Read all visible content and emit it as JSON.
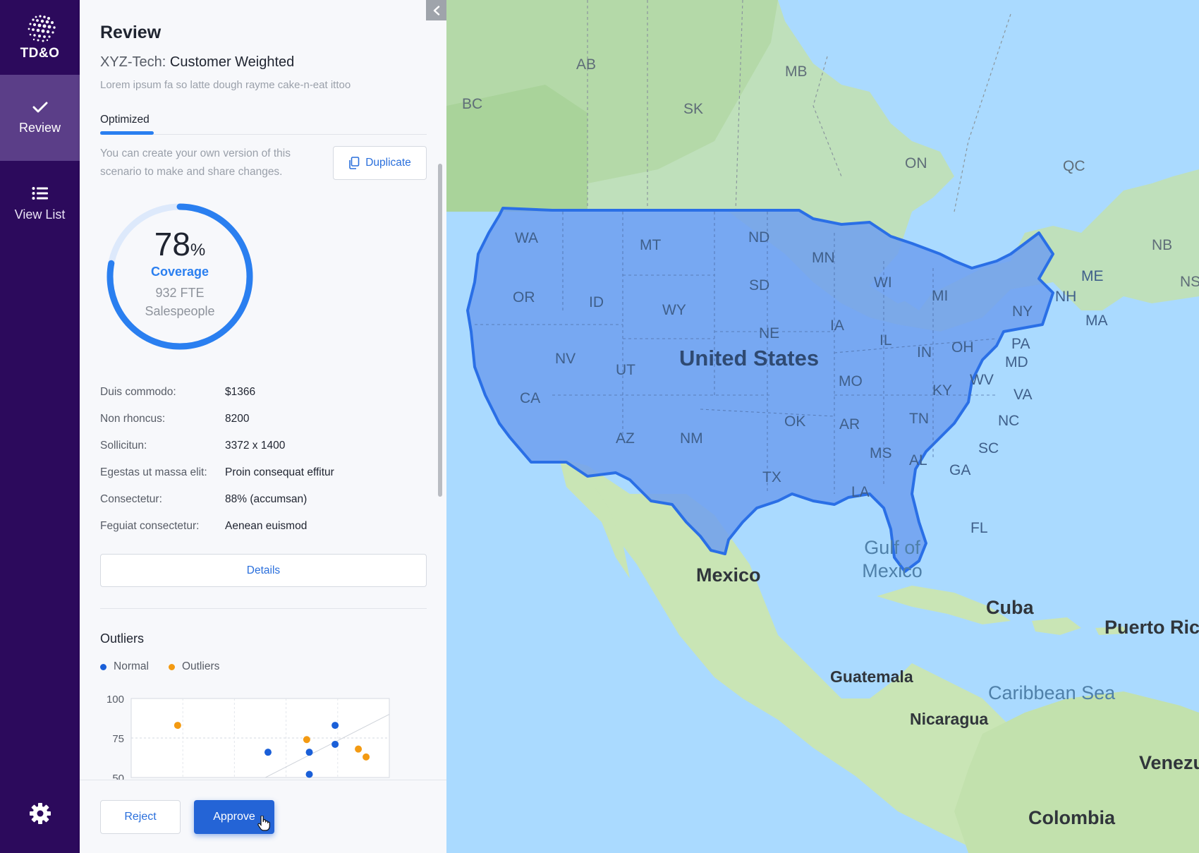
{
  "brand": {
    "name": "TD&O"
  },
  "nav": {
    "items": [
      {
        "id": "review",
        "label": "Review",
        "icon": "check-icon",
        "active": true
      },
      {
        "id": "view-list",
        "label": "View List",
        "icon": "list-icon",
        "active": false
      }
    ],
    "settings_icon": "gear-icon"
  },
  "panel": {
    "title": "Review",
    "subtitle_prefix": "XYZ-Tech:",
    "subtitle": "Customer Weighted",
    "description": "Lorem ipsum fa so latte dough rayme cake-n-eat ittoo",
    "tabs": [
      {
        "label": "Optimized",
        "active": true
      }
    ],
    "duplicate_text": "You can create your own version of this scenario to make and share changes.",
    "duplicate_label": "Duplicate",
    "coverage": {
      "value": "78",
      "percent_sign": "%",
      "fraction": 0.78,
      "label": "Coverage",
      "fte": "932 FTE",
      "role": "Salespeople"
    },
    "stats": [
      {
        "key": "Duis commodo:",
        "value": "$1366"
      },
      {
        "key": "Non rhoncus:",
        "value": "8200"
      },
      {
        "key": "Sollicitun:",
        "value": "3372 x 1400"
      },
      {
        "key": "Egestas ut massa elit:",
        "value": "Proin consequat effitur"
      },
      {
        "key": "Consectetur:",
        "value": "88% (accumsan)"
      },
      {
        "key": "Feguiat consectetur:",
        "value": "Aenean euismod"
      }
    ],
    "details_label": "Details",
    "outliers_title": "Outliers"
  },
  "chart_data": {
    "type": "scatter",
    "title": "Outliers",
    "y_ticks": [
      "100",
      "75",
      "50"
    ],
    "ylim": [
      50,
      100
    ],
    "xlim": [
      0,
      100
    ],
    "series": [
      {
        "name": "Normal",
        "color": "#1a5fd8",
        "points": [
          [
            53,
            66
          ],
          [
            69,
            66
          ],
          [
            79,
            83
          ],
          [
            79,
            71
          ],
          [
            69,
            52
          ]
        ]
      },
      {
        "name": "Outliers",
        "color": "#f39a12",
        "points": [
          [
            18,
            83
          ],
          [
            68,
            74
          ],
          [
            88,
            68
          ],
          [
            91,
            63
          ]
        ]
      }
    ]
  },
  "footer": {
    "reject_label": "Reject",
    "approve_label": "Approve"
  },
  "map": {
    "region_labels": [
      "AB",
      "MB",
      "BC",
      "SK",
      "ON",
      "QC",
      "NB",
      "NS"
    ],
    "state_labels": [
      "WA",
      "MT",
      "ND",
      "MN",
      "OR",
      "ID",
      "WY",
      "SD",
      "WI",
      "MI",
      "NY",
      "NH",
      "ME",
      "MA",
      "IA",
      "NE",
      "IL",
      "IN",
      "OH",
      "PA",
      "MD",
      "NV",
      "UT",
      "MO",
      "KY",
      "WV",
      "VA",
      "CA",
      "OK",
      "AR",
      "TN",
      "NC",
      "AZ",
      "NM",
      "SC",
      "MS",
      "AL",
      "GA",
      "TX",
      "LA",
      "FL"
    ],
    "country_main": "United States",
    "countries": [
      "Mexico",
      "Cuba",
      "Puerto Rico",
      "Guatemala",
      "Nicaragua",
      "Venezuela",
      "Colombia"
    ],
    "water": [
      "Gulf of Mexico",
      "Caribbean Sea"
    ]
  },
  "colors": {
    "nav_bg": "#2c0a5c",
    "nav_active": "#5b3e88",
    "accent": "#2a7ff0",
    "primary_button": "#2464d6",
    "outlier": "#f39a12",
    "normal": "#1a5fd8"
  }
}
